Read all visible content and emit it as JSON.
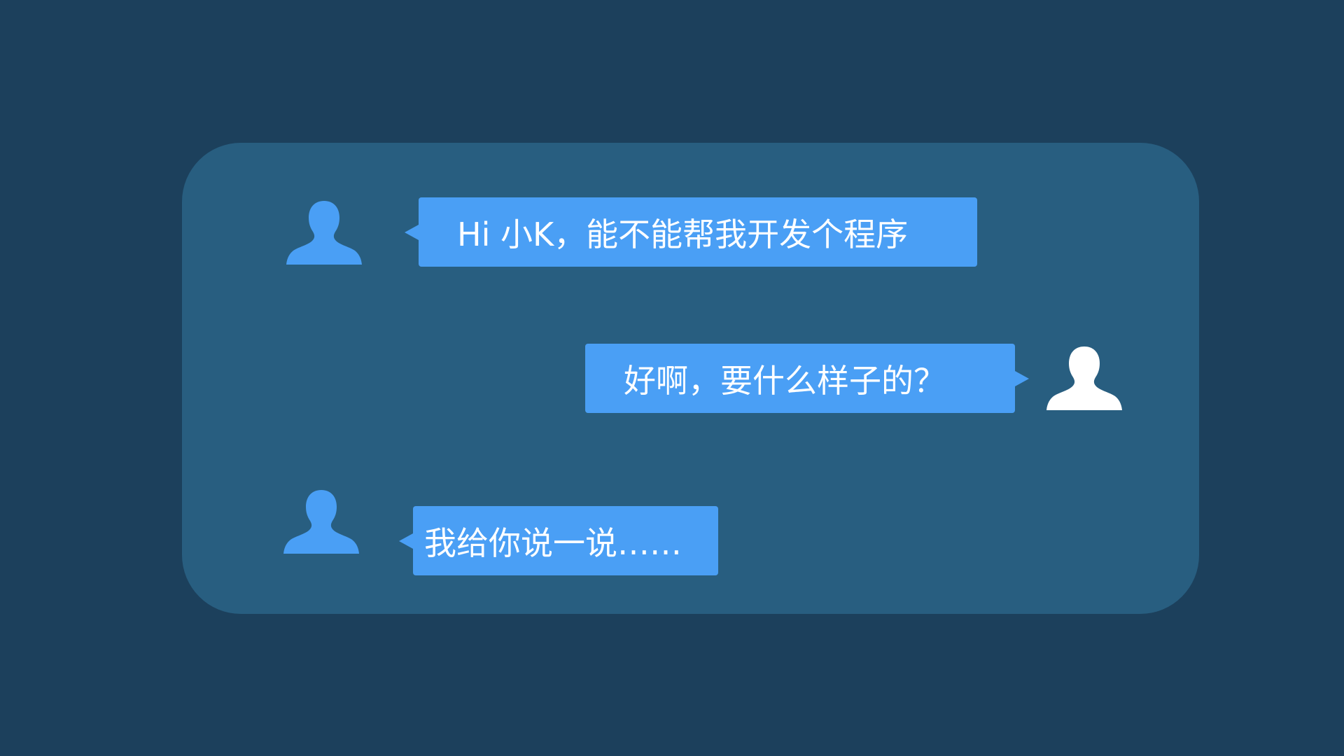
{
  "colors": {
    "background": "#1c405c",
    "panel": "#285e80",
    "bubble": "#4a9ff5",
    "avatar_primary": "#4a9ff5",
    "avatar_secondary": "#ffffff",
    "text": "#ffffff"
  },
  "chat": {
    "messages": [
      {
        "side": "left",
        "avatar_icon": "user-silhouette-icon",
        "text": "Hi 小K，能不能帮我开发个程序"
      },
      {
        "side": "right",
        "avatar_icon": "user-silhouette-icon",
        "text": "好啊，要什么样子的？"
      },
      {
        "side": "left",
        "avatar_icon": "user-silhouette-icon",
        "text": "我给你说一说……"
      }
    ]
  }
}
